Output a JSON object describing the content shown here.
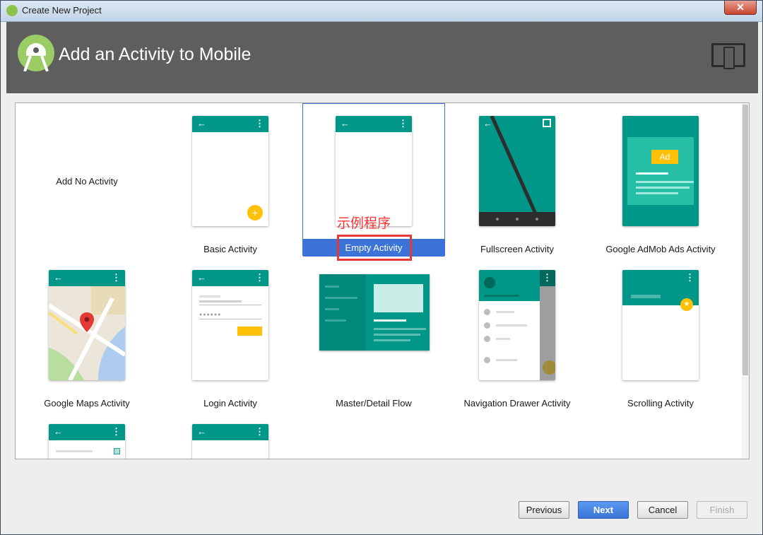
{
  "window": {
    "title": "Create New Project",
    "close_label": "✕"
  },
  "header": {
    "title": "Add an Activity to Mobile"
  },
  "annotation": {
    "text": "示例程序"
  },
  "templates": [
    {
      "label": "Add No Activity"
    },
    {
      "label": "Basic Activity"
    },
    {
      "label": "Empty Activity",
      "selected": true
    },
    {
      "label": "Fullscreen Activity"
    },
    {
      "label": "Google AdMob Ads Activity",
      "badge": "Ad"
    },
    {
      "label": "Google Maps Activity"
    },
    {
      "label": "Login Activity"
    },
    {
      "label": "Master/Detail Flow"
    },
    {
      "label": "Navigation Drawer Activity"
    },
    {
      "label": "Scrolling Activity"
    }
  ],
  "buttons": {
    "previous": "Previous",
    "next": "Next",
    "cancel": "Cancel",
    "finish": "Finish"
  },
  "colors": {
    "accent": "#009688",
    "selection": "#3c73d8",
    "fab": "#ffc107",
    "header_bg": "#5e5e5e"
  }
}
